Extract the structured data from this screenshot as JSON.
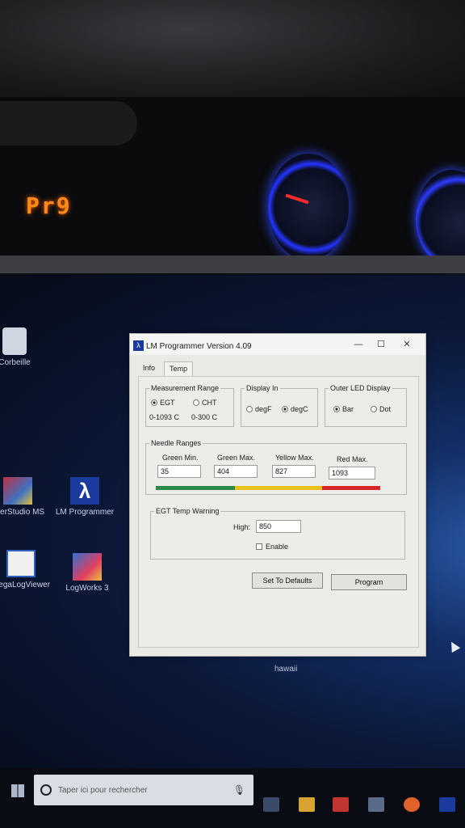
{
  "dashboard": {
    "readout": "Pr9"
  },
  "desktop": {
    "icons": [
      {
        "label": "Corbeille"
      },
      {
        "label": "unerStudio MS"
      },
      {
        "label": "LM Programmer"
      },
      {
        "label": "MegaLogViewer"
      },
      {
        "label": "LogWorks 3"
      }
    ],
    "folder_label": "hawaii"
  },
  "window": {
    "title": "LM Programmer Version 4.09",
    "controls": {
      "minimize": "—",
      "maximize": "☐",
      "close": "✕"
    },
    "tabs": [
      {
        "label": "Info",
        "active": false
      },
      {
        "label": "Temp",
        "active": true
      }
    ],
    "measurement_range": {
      "legend": "Measurement Range",
      "options": [
        {
          "label": "EGT",
          "range": "0-1093 C",
          "selected": true
        },
        {
          "label": "CHT",
          "range": "0-300 C",
          "selected": false
        }
      ]
    },
    "display_in": {
      "legend": "Display In",
      "options": [
        {
          "label": "degF",
          "selected": false
        },
        {
          "label": "degC",
          "selected": true
        }
      ]
    },
    "outer_led": {
      "legend": "Outer LED Display",
      "options": [
        {
          "label": "Bar",
          "selected": true
        },
        {
          "label": "Dot",
          "selected": false
        }
      ]
    },
    "needle_ranges": {
      "legend": "Needle Ranges",
      "fields": [
        {
          "label": "Green Min.",
          "value": "35"
        },
        {
          "label": "Green Max.",
          "value": "404"
        },
        {
          "label": "Yellow Max.",
          "value": "827"
        },
        {
          "label": "Red Max.",
          "value": "1093"
        }
      ],
      "bar_colors": {
        "green": "#2e8a4a",
        "yellow": "#e8c21a",
        "red": "#d6262a"
      }
    },
    "egt_warning": {
      "legend": "EGT Temp Warning",
      "high_label": "High:",
      "high_value": "850",
      "enable_label": "Enable",
      "enable_checked": false
    },
    "buttons": {
      "defaults": "Set To Defaults",
      "program": "Program"
    }
  },
  "taskbar": {
    "search_placeholder": "Taper ici pour rechercher"
  }
}
